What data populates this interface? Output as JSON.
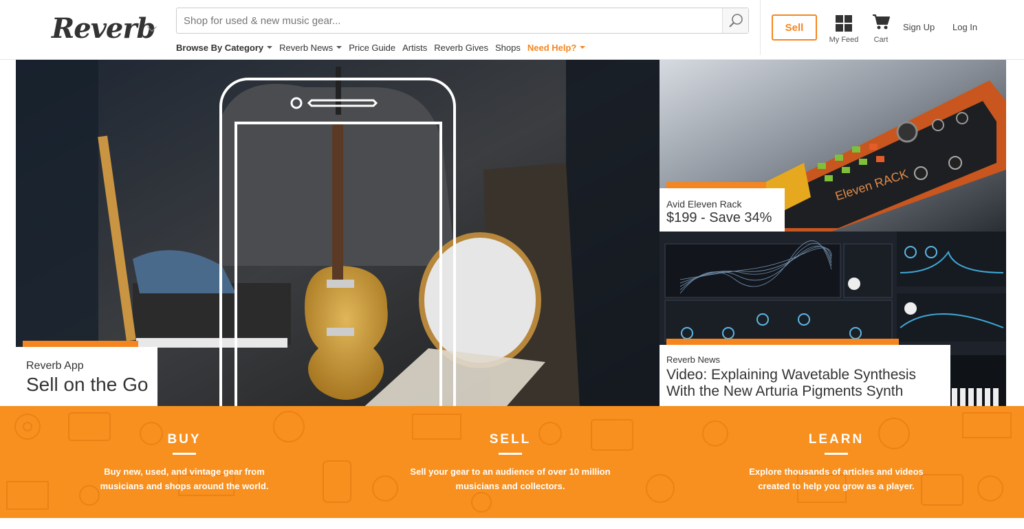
{
  "header": {
    "logo": "Reverb",
    "search_placeholder": "Shop for used & new music gear...",
    "nav": [
      {
        "label": "Browse By Category"
      },
      {
        "label": "Reverb News"
      },
      {
        "label": "Price Guide"
      },
      {
        "label": "Artists"
      },
      {
        "label": "Reverb Gives"
      },
      {
        "label": "Shops"
      },
      {
        "label": "Need Help?"
      }
    ],
    "sell_label": "Sell",
    "my_feed_label": "My Feed",
    "cart_label": "Cart",
    "sign_up_label": "Sign Up",
    "log_in_label": "Log In"
  },
  "hero": {
    "main": {
      "kicker": "Reverb App",
      "title": "Sell on the Go"
    },
    "side_top": {
      "kicker": "Avid Eleven Rack",
      "title": "$199 - Save 34%",
      "device_label": "Eleven RACK"
    },
    "side_bottom": {
      "kicker": "Reverb News",
      "title": "Video: Explaining Wavetable Synthesis With the New Arturia Pigments Synth"
    }
  },
  "band": {
    "columns": [
      {
        "heading": "BUY",
        "text": "Buy new, used, and vintage gear from musicians and shops around the world."
      },
      {
        "heading": "SELL",
        "text": "Sell your gear to an audience of over 10 million musicians and collectors."
      },
      {
        "heading": "LEARN",
        "text": "Explore thousands of articles and videos created to help you grow as a player."
      }
    ]
  },
  "colors": {
    "accent": "#f5861f",
    "band": "#f7901e"
  },
  "icons": [
    "search-icon",
    "grid-icon",
    "cart-icon",
    "chevron-down-icon"
  ]
}
